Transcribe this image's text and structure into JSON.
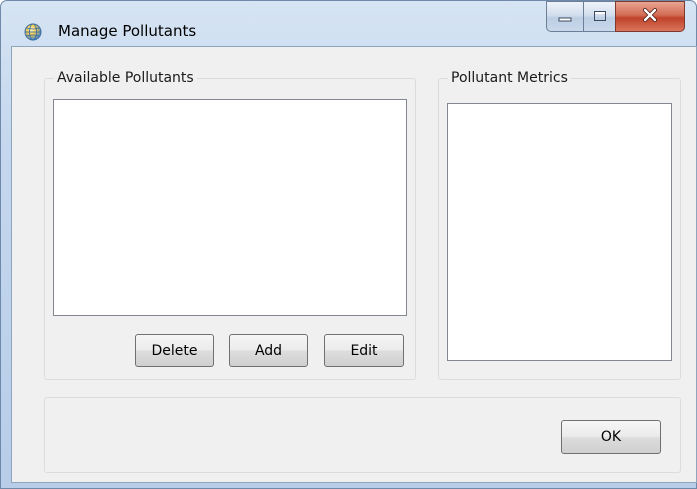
{
  "window": {
    "title": "Manage Pollutants",
    "icon": "globe-icon",
    "controls": {
      "minimize_icon": "minimize-icon",
      "maximize_icon": "maximize-icon",
      "close_icon": "close-icon"
    }
  },
  "available_pollutants": {
    "label": "Available Pollutants",
    "items": [],
    "buttons": {
      "delete": "Delete",
      "add": "Add",
      "edit": "Edit"
    }
  },
  "pollutant_metrics": {
    "label": "Pollutant Metrics",
    "items": []
  },
  "footer": {
    "ok": "OK"
  },
  "colors": {
    "titlebar": "#c4d7ee",
    "client_bg": "#f0f0f0",
    "close_button": "#c0422a"
  }
}
